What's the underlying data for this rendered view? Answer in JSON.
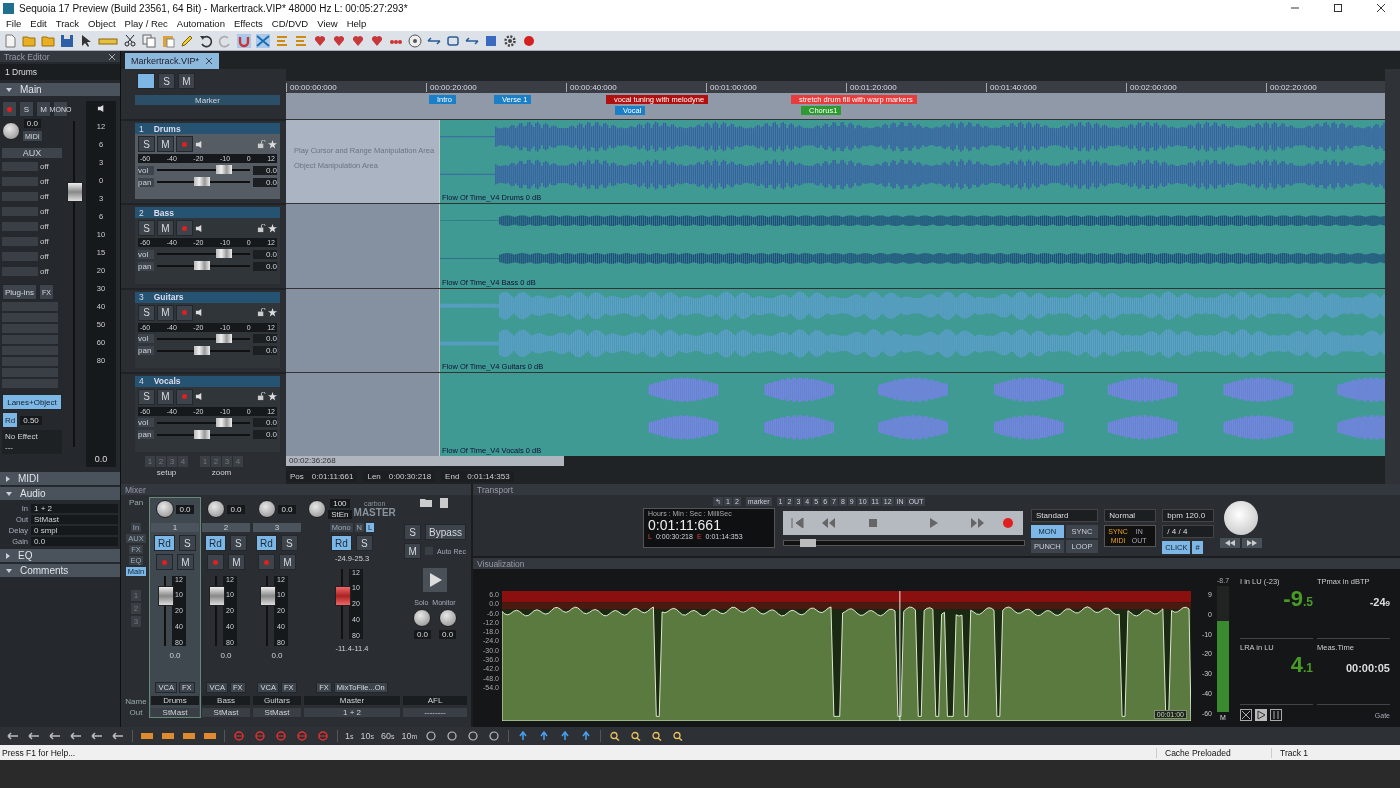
{
  "window": {
    "title": "Sequoia 17 Preview (Build 23561, 64 Bit)  -  Markertrack.VIP*   48000 Hz L: 00:05:27:293*"
  },
  "menu": [
    "File",
    "Edit",
    "Track",
    "Object",
    "Play / Rec",
    "Automation",
    "Effects",
    "CD/DVD",
    "View",
    "Help"
  ],
  "track_editor": {
    "title": "Track Editor",
    "track": "1  Drums",
    "main": {
      "label": "Main",
      "expanded": true
    },
    "buttons": [
      "S",
      "M",
      "MONO"
    ],
    "pan_value": "0.0",
    "midi": "MIDI",
    "aux": "AUX",
    "aux_sends": [
      "off",
      "off",
      "off",
      "off",
      "off",
      "off",
      "off",
      "off"
    ],
    "plugins": "Plug-ins",
    "fx": "FX",
    "mode": "Lanes+Object",
    "rd": "Rd",
    "rd_value": "0.50",
    "effect": "No Effect",
    "effect_sub": "---",
    "scale": [
      "12",
      "6",
      "3",
      "0",
      "3",
      "6",
      "10",
      "15",
      "20",
      "30",
      "40",
      "50",
      "60",
      "80"
    ],
    "reading": "0.0",
    "fader": {
      "level": 0.78
    },
    "sections": [
      {
        "label": "MIDI",
        "expanded": false
      },
      {
        "label": "Audio",
        "expanded": true,
        "fields": [
          {
            "label": "In",
            "value": "1 + 2"
          },
          {
            "label": "Out",
            "value": "StMast"
          },
          {
            "label": "Delay",
            "value": "0 smpl"
          },
          {
            "label": "Gain",
            "value": "0.0"
          }
        ]
      },
      {
        "label": "EQ",
        "expanded": false
      },
      {
        "label": "Comments",
        "expanded": true
      }
    ]
  },
  "project": {
    "tab": "Markertrack.VIP*",
    "solo": "S",
    "mute": "M",
    "marker_track": "Marker"
  },
  "ruler": [
    "00:00:00:000",
    "00:00:20:000",
    "00:00:40:000",
    "00:01:00:000",
    "00:01:20:000",
    "00:01:40:000",
    "00:02:00:000",
    "00:02:20:000"
  ],
  "markers": {
    "upper": [
      {
        "label": "Intro",
        "color": "#1a7fc6"
      },
      {
        "label": "Verse 1",
        "color": "#1a7fc6"
      },
      {
        "label": "vocal tuning with melodyne",
        "color": "#b01010"
      },
      {
        "label": "stretch drum fill with warp markers",
        "color": "#e83c3c"
      }
    ],
    "lower": [
      {
        "label": "Vocal",
        "color": "#1a7fc6"
      },
      {
        "label": "Chorus1",
        "color": "#2f9a2f"
      }
    ]
  },
  "area_labels": [
    "Play Cursor and Range Manipulation Area",
    "Object Manipulation Area"
  ],
  "tracks": [
    {
      "number": "1",
      "name": "Drums",
      "selected": true,
      "kind": "drums",
      "solo": "S",
      "mute": "M",
      "meter_scale": [
        "-60",
        "-40",
        "-20",
        "-10",
        "0",
        "12"
      ],
      "vol": {
        "label": "vol",
        "level": 0.72,
        "reading": "0.0"
      },
      "pan": {
        "label": "pan",
        "level": 0.48,
        "reading": "0.0"
      },
      "clip": "Flow Of Time_V4 Drums  0 dB"
    },
    {
      "number": "2",
      "name": "Bass",
      "selected": false,
      "kind": "bass",
      "solo": "S",
      "mute": "M",
      "meter_scale": [
        "-60",
        "-40",
        "-20",
        "-10",
        "0",
        "12"
      ],
      "vol": {
        "label": "vol",
        "level": 0.72,
        "reading": "0.0"
      },
      "pan": {
        "label": "pan",
        "level": 0.48,
        "reading": "0.0"
      },
      "clip": "Flow Of Time_V4 Bass  0 dB"
    },
    {
      "number": "3",
      "name": "Guitars",
      "selected": false,
      "kind": "guitars",
      "solo": "S",
      "mute": "M",
      "meter_scale": [
        "-60",
        "-40",
        "-20",
        "-10",
        "0",
        "12"
      ],
      "vol": {
        "label": "vol",
        "level": 0.72,
        "reading": "0.0"
      },
      "pan": {
        "label": "pan",
        "level": 0.48,
        "reading": "0.0"
      },
      "clip": "Flow Of Time_V4 Guitars  0 dB"
    },
    {
      "number": "4",
      "name": "Vocals",
      "selected": false,
      "kind": "vocals",
      "solo": "S",
      "mute": "M",
      "meter_scale": [
        "-60",
        "-40",
        "-20",
        "-10",
        "0",
        "12"
      ],
      "vol": {
        "label": "vol",
        "level": 0.72,
        "reading": "0.0"
      },
      "pan": {
        "label": "pan",
        "level": 0.48,
        "reading": "0.0"
      },
      "clip": "Flow Of Time_V4 Vocals  0 dB"
    }
  ],
  "setup": {
    "label": "setup",
    "keys": [
      "1",
      "2",
      "3",
      "4"
    ]
  },
  "zoom": {
    "label": "zoom",
    "keys": [
      "1",
      "2",
      "3",
      "4"
    ]
  },
  "position_bar": {
    "scroll_time": "00:02:36:268",
    "fields": [
      {
        "label": "Pos",
        "value": "0:01:11:661"
      },
      {
        "label": "Len",
        "value": "0:00:30:218"
      },
      {
        "label": "End",
        "value": "0:01:14:353"
      }
    ]
  },
  "mixer": {
    "title": "Mixer",
    "pan_label": "Pan",
    "row_labels": [
      {
        "label": "In",
        "selected": false
      },
      {
        "label": "AUX",
        "selected": false
      },
      {
        "label": "FX",
        "selected": false
      },
      {
        "label": "EQ",
        "selected": false
      },
      {
        "label": "Main",
        "selected": true
      }
    ],
    "groups": [
      "1",
      "2",
      "3"
    ],
    "name_label": "Name",
    "out_label": "Out",
    "channels": [
      {
        "number": "1",
        "name": "Drums",
        "pan": "0.0",
        "reading": "0.0",
        "out": "StMast",
        "selected": true,
        "rd": "Rd",
        "solo": "S",
        "mute": "M",
        "vca": "VCA",
        "fx": "FX",
        "meter_scale": [
          "12",
          "10",
          "20",
          "40",
          "80"
        ],
        "fader": {
          "level": 0.7
        }
      },
      {
        "number": "2",
        "name": "Bass",
        "pan": "0.0",
        "reading": "0.0",
        "out": "StMast",
        "selected": false,
        "rd": "Rd",
        "solo": "S",
        "mute": "M",
        "vca": "VCA",
        "fx": "FX",
        "meter_scale": [
          "12",
          "10",
          "20",
          "40",
          "80"
        ],
        "fader": {
          "level": 0.7
        }
      },
      {
        "number": "3",
        "name": "Guitars",
        "pan": "0.0",
        "reading": "0.0",
        "out": "StMast",
        "selected": false,
        "rd": "Rd",
        "solo": "S",
        "mute": "M",
        "vca": "VCA",
        "fx": "FX",
        "meter_scale": [
          "12",
          "10",
          "20",
          "40",
          "80"
        ],
        "fader": {
          "level": 0.7
        }
      }
    ],
    "master": {
      "pan": "100",
      "mode": "StEn",
      "mono": "Mono",
      "n": "N",
      "l": "L",
      "rd": "Rd",
      "solo": "S",
      "name": "Master",
      "out": "1 + 2",
      "peak": "-24.9-25.3",
      "rms": "-11.4-11.4",
      "fx": "FX",
      "mix": "MixToFile...On",
      "brand": "carbon",
      "title": "MASTER",
      "meter_scale": [
        "12",
        "10",
        "20",
        "40",
        "80"
      ],
      "fader": {
        "level": 0.6
      }
    },
    "monitor": {
      "solo": "S",
      "bypass": "Bypass",
      "mute": "M",
      "auto_rec": {
        "label": "Auto Rec",
        "checked": false
      },
      "solo_label": "Solo",
      "monitor_label": "Monitor",
      "solo_value": "0.0",
      "monitor_value": "0.0",
      "afl": "AFL",
      "out": "--------"
    }
  },
  "transport": {
    "title": "Transport",
    "undo": "↰",
    "locators": [
      "1",
      "2"
    ],
    "marker": "marker",
    "marker_keys": [
      "1",
      "2",
      "3",
      "4",
      "5",
      "6",
      "7",
      "8",
      "9",
      "10",
      "11",
      "12"
    ],
    "in": "IN",
    "out": "OUT",
    "display": {
      "caption": "Hours : Min : Sec : MilliSec",
      "time": "0:01:11:661",
      "l_label": "L",
      "l": "0:00:30:218",
      "e_label": "E",
      "e": "0:01:14:353"
    },
    "position": {
      "level": 0.1
    },
    "mode": "Standard",
    "buttons": [
      {
        "label": "MON",
        "on": true
      },
      {
        "label": "SYNC",
        "on": false
      },
      {
        "label": "PUNCH",
        "on": false
      },
      {
        "label": "LOOP",
        "on": false
      }
    ],
    "speed": "Normal",
    "bpm": "bpm 120.0",
    "meter": "/   4 / 4",
    "sync": {
      "sync": "SYNC",
      "midi": "MIDI",
      "in": "IN",
      "out": "OUT"
    },
    "click": {
      "label": "CLICK",
      "on": true
    },
    "grid": "#"
  },
  "visualization": {
    "title": "Visualization",
    "scale": [
      "6.0",
      "0.0",
      "-6.0",
      "-12.0",
      "-18.0",
      "-24.0",
      "-30.0",
      "-36.0",
      "-42.0",
      "-48.0",
      "-54.0"
    ],
    "time_tag": "00:01:00",
    "meter_peak": "-8.7",
    "meter_scale": [
      "9",
      "0",
      "-10",
      "-20",
      "-30",
      "-40",
      "-60"
    ],
    "meter": {
      "level": 0.72
    },
    "meter_mode": "M",
    "readouts": [
      {
        "label": "I in LU (-23)",
        "value": "-9",
        "decimal": ".5",
        "kind": "big"
      },
      {
        "label": "TPmax in dBTP",
        "value": "-24",
        "decimal": "9",
        "kind": "small"
      },
      {
        "label": "LRA in LU",
        "value": "4",
        "decimal": ".1",
        "kind": "big"
      },
      {
        "label": "Meas.Time",
        "value": "00:00:05",
        "kind": "small"
      }
    ],
    "gate": "Gate"
  },
  "bottom_toolbar": {
    "durations": [
      {
        "value": "1",
        "unit": "s"
      },
      {
        "value": "10",
        "unit": "s"
      },
      {
        "value": "60",
        "unit": "s"
      },
      {
        "value": "10",
        "unit": "m"
      }
    ]
  },
  "status": {
    "help": "Press F1 for Help...",
    "cache": "Cache Preloaded",
    "track": "Track 1"
  }
}
